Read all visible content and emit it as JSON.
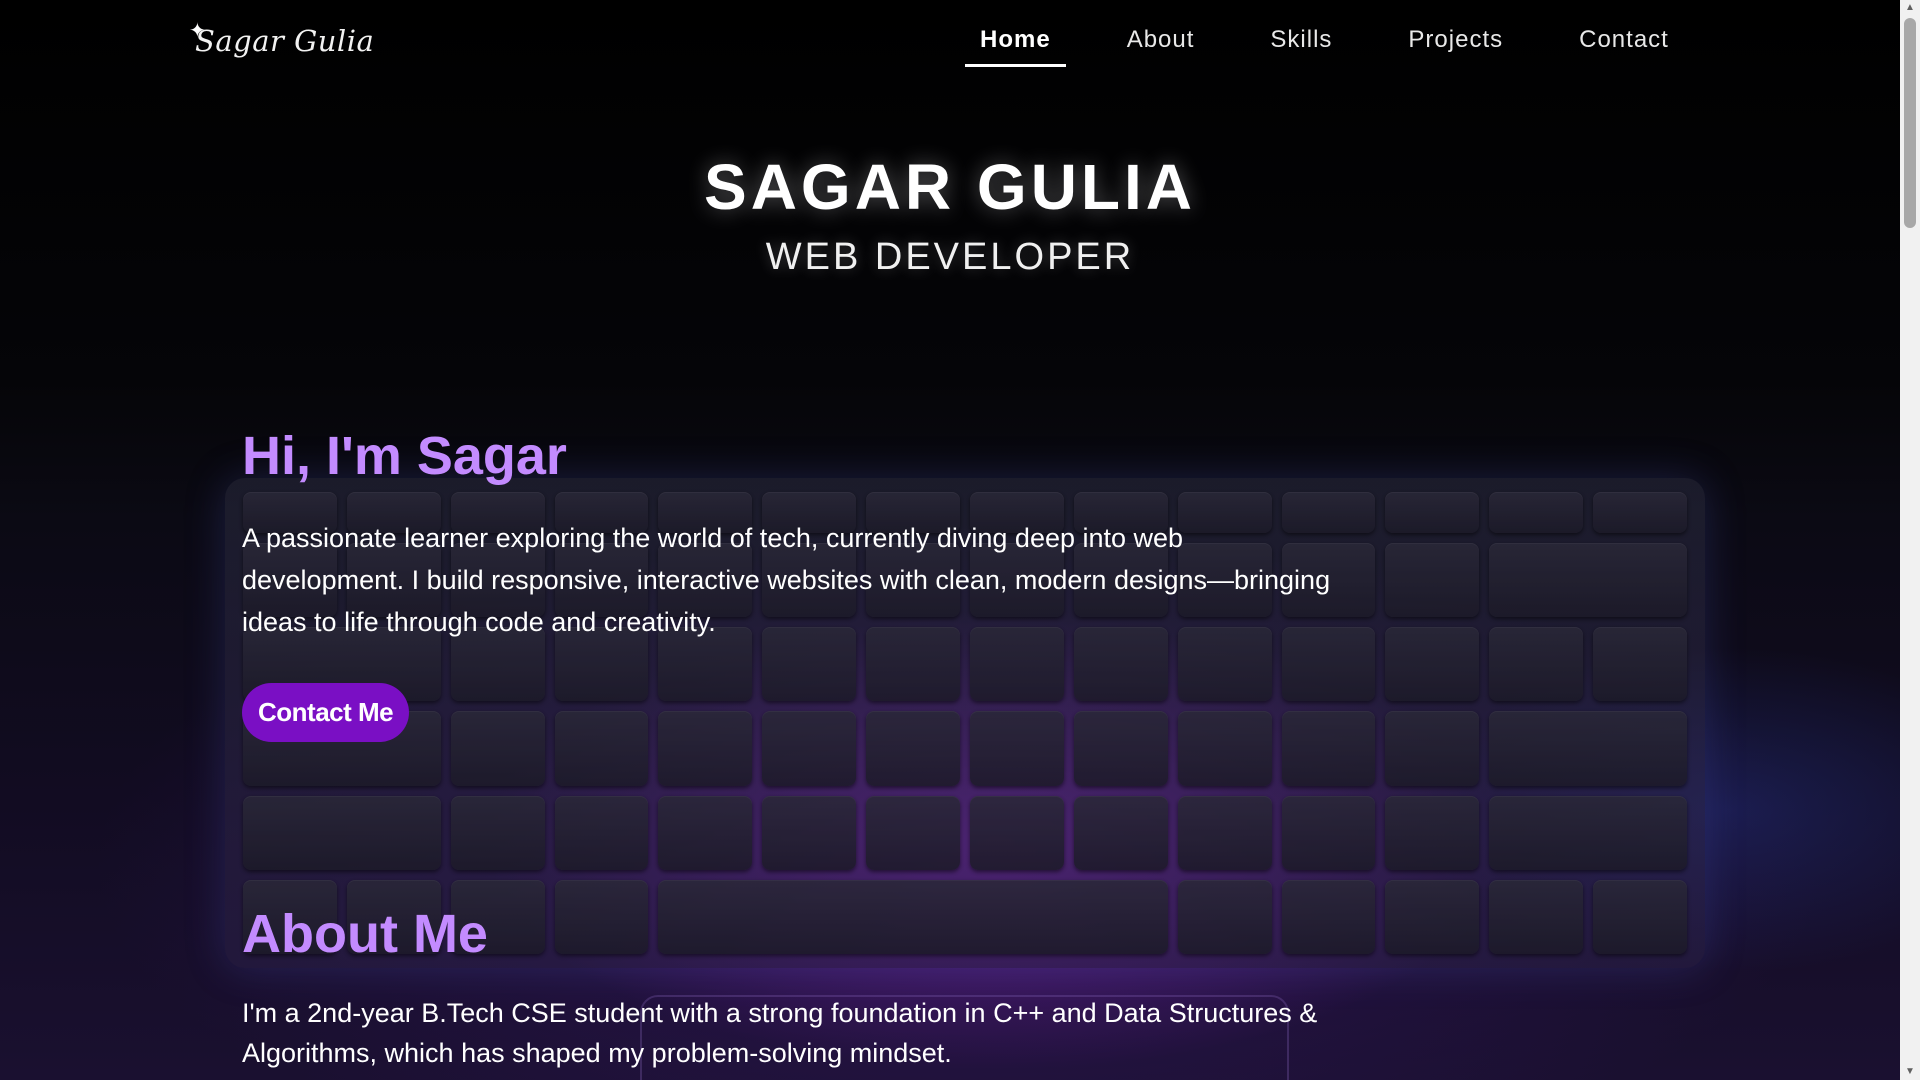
{
  "nav": {
    "logo": "Sagar Gulia",
    "logo_star": "✦",
    "links": [
      {
        "label": "Home",
        "active": true
      },
      {
        "label": "About",
        "active": false
      },
      {
        "label": "Skills",
        "active": false
      },
      {
        "label": "Projects",
        "active": false
      },
      {
        "label": "Contact",
        "active": false
      }
    ]
  },
  "hero": {
    "name": "SAGAR GULIA",
    "role": "WEB DEVELOPER"
  },
  "intro": {
    "heading": "Hi, I'm Sagar",
    "text": "A passionate learner exploring the world of tech, currently diving deep into web development. I build responsive, interactive websites with clean, modern designs—bringing ideas to life through code and creativity.",
    "button_label": "Contact Me"
  },
  "about": {
    "heading": "About Me",
    "text": "I'm a 2nd-year B.Tech CSE student with a strong foundation in C++ and Data Structures & Algorithms, which has shaped my problem-solving mindset."
  },
  "colors": {
    "accent": "#c38bff",
    "button": "#7a0fc4",
    "background": "#000000"
  },
  "scrollbar": {
    "up_icon": "▲",
    "down_icon": "▼"
  }
}
